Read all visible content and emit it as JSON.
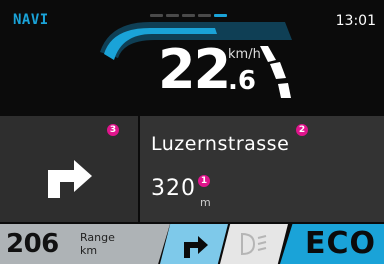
{
  "header": {
    "mode_label": "NAVI",
    "time": "13:01",
    "page_indicator": {
      "count": 5,
      "active_index": 4
    }
  },
  "speedometer": {
    "integer": "22",
    "decimal": ".6",
    "unit": "km/h"
  },
  "navigation": {
    "maneuver_icon": "turn-right-arrow",
    "street": "Luzernstrasse",
    "distance_value": "320",
    "distance_unit": "m",
    "callouts": [
      "1",
      "2",
      "3"
    ]
  },
  "status_bar": {
    "range_value": "206",
    "range_label": "Range",
    "range_unit": "km",
    "turn_indicator_icon": "turn-right-arrow",
    "headlight_icon": "low-beam-icon",
    "mode": "ECO"
  },
  "colors": {
    "accent": "#1aa3d8",
    "badge": "#e0148c",
    "panel": "#333333",
    "range_bg": "#aeb3b6",
    "indicator_bg": "#7ec9ea"
  }
}
